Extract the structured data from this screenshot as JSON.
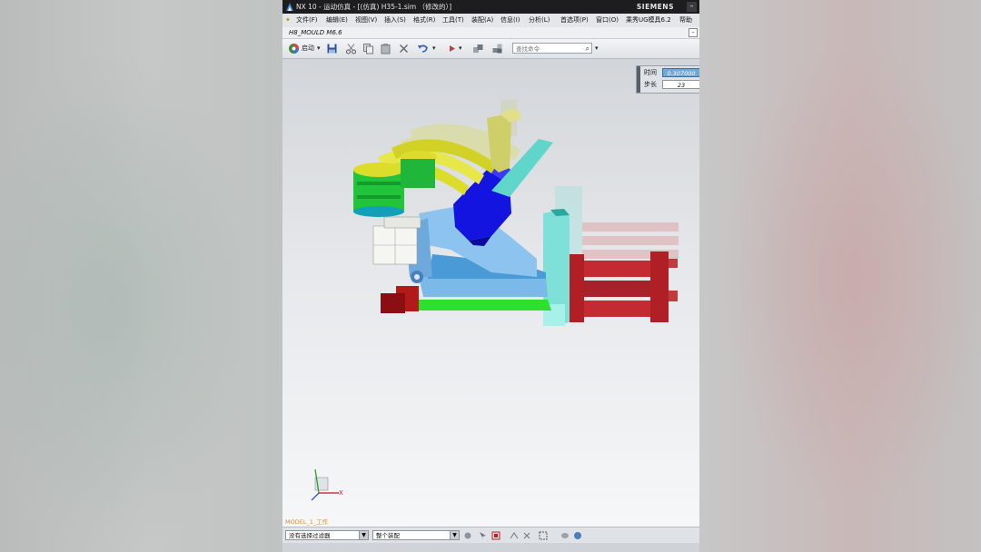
{
  "window": {
    "title": "NX 10 - 运动仿真 - [(仿真) H35-1.sim （修改的）]",
    "brand": "SIEMENS",
    "minimize": "–"
  },
  "menu": {
    "items": [
      "文件(F)",
      "编辑(E)",
      "视图(V)",
      "插入(S)",
      "格式(R)",
      "工具(T)",
      "装配(A)",
      "信息(I)",
      "分析(L)",
      "首选项(P)",
      "窗口(O)",
      "乘秀UG模具6.2",
      "帮助"
    ]
  },
  "document": {
    "name": "H8_MOULD M6.6"
  },
  "toolbar": {
    "start_label": "启动",
    "search_placeholder": "查找命令"
  },
  "animation": {
    "time_label": "时间",
    "time_value": "0.307000",
    "step_label": "步长",
    "step_value": "23"
  },
  "viewport": {
    "model_label": "MODEL_1_工作",
    "axis_x": "X"
  },
  "statusbar": {
    "filter_value": "没有选择过滤器",
    "scope_value": "整个装配"
  },
  "colors": {
    "accent": "#6fa8dc",
    "title_bg": "#1d1d1f",
    "part_blue": "#1414e0",
    "part_red": "#b01e26",
    "part_green": "#2ee02e",
    "part_cyan": "#7fe0d9",
    "part_yellow": "#dcdc2a"
  }
}
